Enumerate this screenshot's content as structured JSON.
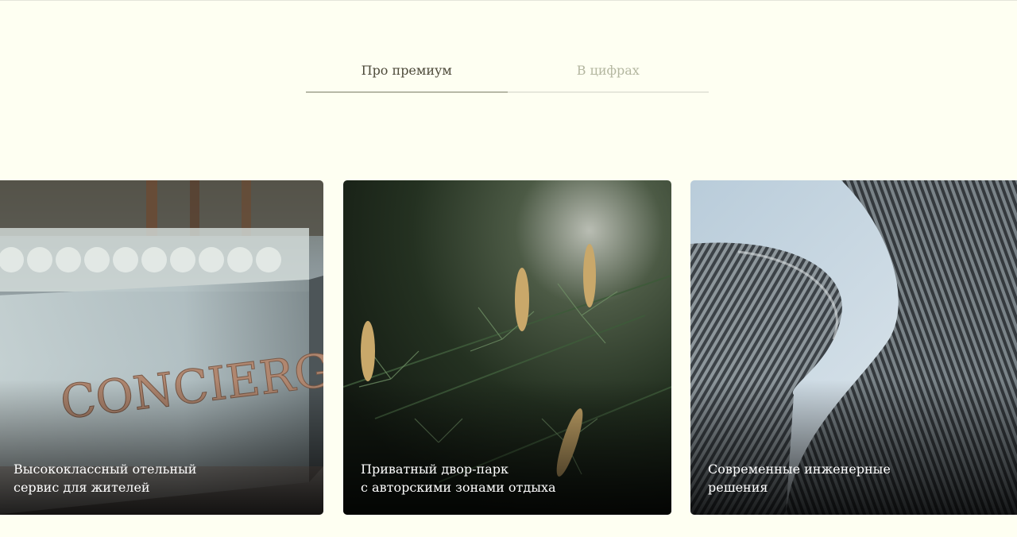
{
  "tabs": [
    {
      "label": "Про премиум",
      "active": true
    },
    {
      "label": "В цифрах",
      "active": false
    }
  ],
  "cards": [
    {
      "caption": "Высококлассный отельный\nсервис для жителей",
      "image_text": "CONCIERGE"
    },
    {
      "caption": "Приватный двор-парк\nс авторскими зонами отдыха"
    },
    {
      "caption": "Современные инженерные\nрешения"
    }
  ],
  "colors": {
    "background": "#fefff2",
    "tab_active": "#4d4a3a",
    "tab_inactive": "#b4b7a0",
    "caption": "#ffffff"
  }
}
